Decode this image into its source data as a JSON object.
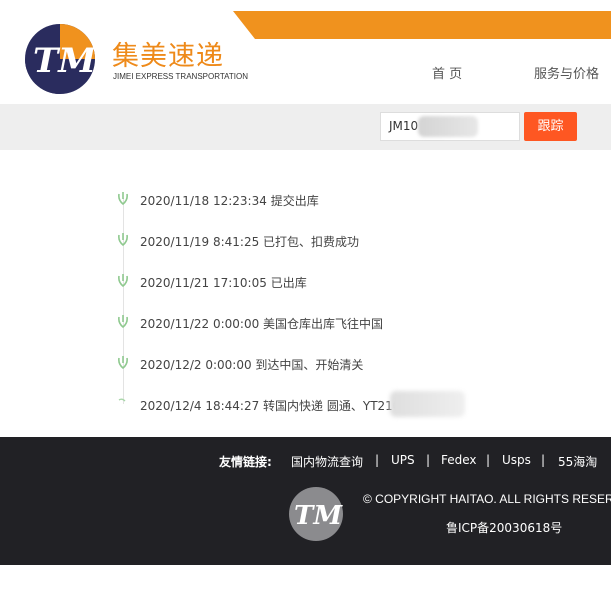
{
  "brand": {
    "name_cn": "集美速递",
    "name_en": "JIMEI   EXPRESS TRANSPORTATION",
    "accent_color": "#f0921e",
    "logo_dark_color": "#2a2c5e"
  },
  "nav": {
    "home": "首 页",
    "pricing": "服务与价格"
  },
  "search": {
    "tracking_value": "JM10",
    "button_label": "跟踪",
    "button_color": "#fe5722"
  },
  "timeline": [
    {
      "text": "2020/11/18 12:23:34 提交出库"
    },
    {
      "text": "2020/11/19 8:41:25 已打包、扣费成功"
    },
    {
      "text": "2020/11/21 17:10:05 已出库"
    },
    {
      "text": "2020/11/22 0:00:00 美国仓库出库飞往中国"
    },
    {
      "text": "2020/12/2 0:00:00 到达中国、开始清关"
    },
    {
      "text": "2020/12/4 18:44:27 转国内快递 圆通、YT210"
    }
  ],
  "footer": {
    "links_label": "友情链接:",
    "links": [
      "国内物流查询",
      "UPS",
      "Fedex",
      "Usps",
      "55海淘"
    ],
    "separator": "|",
    "copyright": "© COPYRIGHT HAITAO. ALL RIGHTS RESERV",
    "icp": "鲁ICP备20030618号"
  }
}
